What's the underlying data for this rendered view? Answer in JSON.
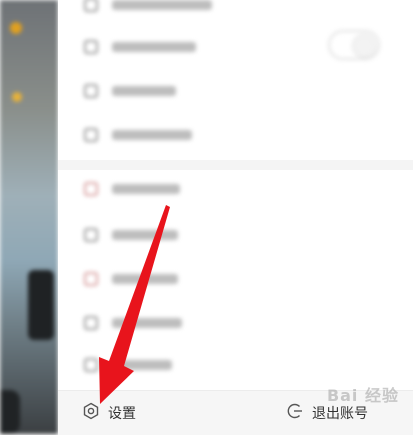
{
  "bottom_bar": {
    "settings_label": "设置",
    "logout_label": "退出账号"
  },
  "menu": {
    "toggle_on": false
  },
  "watermark": {
    "text": "Bai 经验"
  },
  "icons": {
    "settings": "hexagon-gear-icon",
    "logout": "power-exit-icon"
  },
  "colors": {
    "arrow": "#e8141c",
    "bottom_bar_bg": "#f6f6f6",
    "text": "#333333"
  }
}
